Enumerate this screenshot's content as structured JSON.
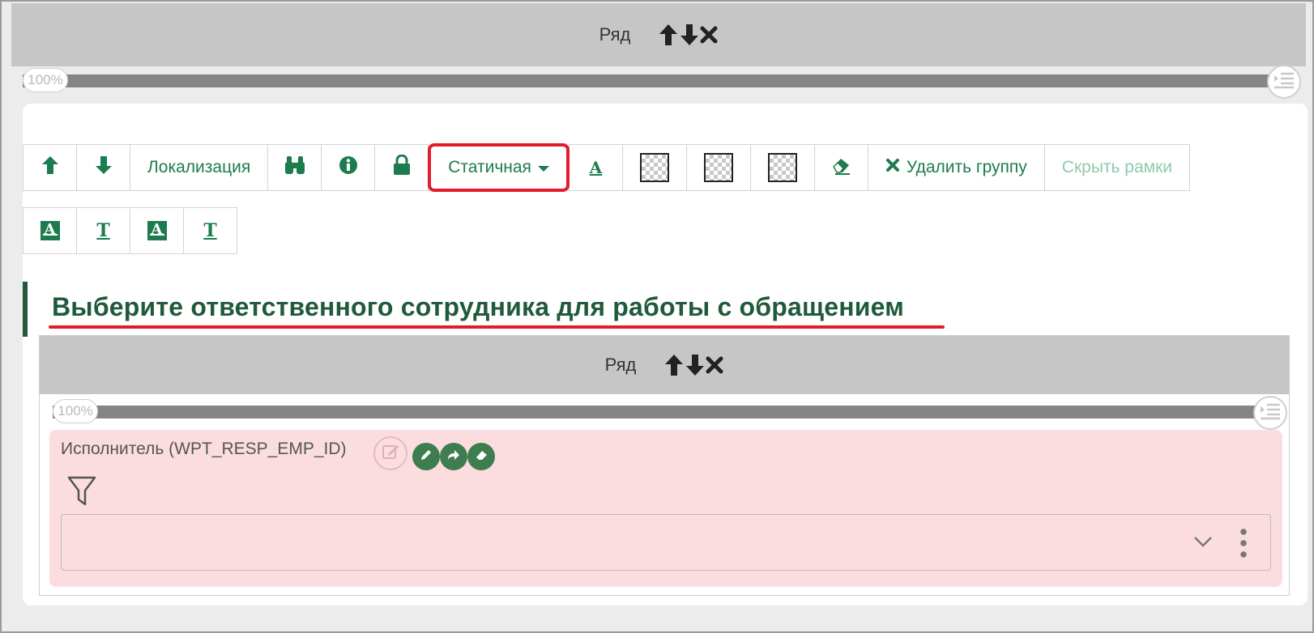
{
  "outer_row": {
    "label": "Ряд",
    "width_percent": "100%"
  },
  "toolbar": {
    "up_icon": "arrow-up-icon",
    "down_icon": "arrow-down-icon",
    "localization_label": "Локализация",
    "search_icon": "binoculars-icon",
    "info_icon": "info-icon",
    "lock_icon": "lock-icon",
    "mode_label": "Статичная",
    "delete_group_label": "Удалить группу",
    "hide_frames_label": "Скрыть рамки",
    "text_style_buttons": [
      "A",
      "T",
      "A",
      "T"
    ]
  },
  "group": {
    "title": "Выберите ответственного сотрудника для работы с обращением"
  },
  "inner_row": {
    "label": "Ряд",
    "width_percent": "100%"
  },
  "field": {
    "label": "Исполнитель (WPT_RESP_EMP_ID)",
    "value": ""
  },
  "colors": {
    "accent_green": "#1c7c4e",
    "highlight_red": "#e41b2c",
    "field_bg": "#fbdde0",
    "row_header_bg": "#c6c6c6"
  }
}
